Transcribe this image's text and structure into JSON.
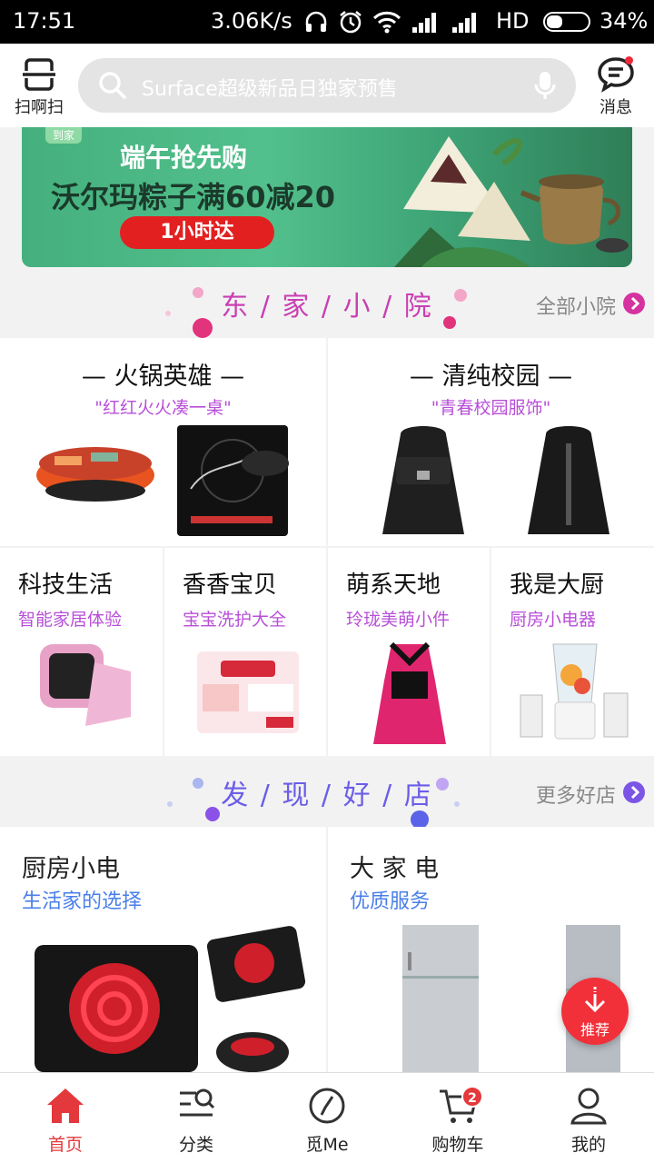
{
  "status_bar": {
    "time": "17:51",
    "net_speed": "3.06K/s",
    "network_type": "HD",
    "battery": "34%"
  },
  "topbar": {
    "scan_label": "扫啊扫",
    "search_placeholder": "Surface超级新品日独家预售",
    "message_label": "消息"
  },
  "banner": {
    "line1": "端午抢先购",
    "line2": "沃尔玛粽子满60减20",
    "cta": "1小时达",
    "badge": "到家"
  },
  "dong_section": {
    "title": "东 / 家 / 小 / 院",
    "more": "全部小院",
    "featured": [
      {
        "title": "— 火锅英雄 —",
        "subtitle": "\"红红火火凑一桌\""
      },
      {
        "title": "— 清纯校园 —",
        "subtitle": "\"青春校园服饰\""
      }
    ],
    "cells": [
      {
        "title": "科技生活",
        "subtitle": "智能家居体验"
      },
      {
        "title": "香香宝贝",
        "subtitle": "宝宝洗护大全"
      },
      {
        "title": "萌系天地",
        "subtitle": "玲珑美萌小件"
      },
      {
        "title": "我是大厨",
        "subtitle": "厨房小电器"
      }
    ]
  },
  "fa_section": {
    "title": "发 / 现 / 好 / 店",
    "more": "更多好店",
    "stores": [
      {
        "title": "厨房小电",
        "subtitle": "生活家的选择"
      },
      {
        "title": "大 家 电",
        "subtitle": "优质服务"
      }
    ]
  },
  "fab": {
    "label": "推荐"
  },
  "bottom_nav": [
    {
      "label": "首页",
      "active": true
    },
    {
      "label": "分类",
      "active": false
    },
    {
      "label": "觅Me",
      "active": false
    },
    {
      "label": "购物车",
      "active": false,
      "badge": "2"
    },
    {
      "label": "我的",
      "active": false
    }
  ],
  "colors": {
    "accent_red": "#e4393c",
    "purple_sub": "#b84fd8",
    "blue_sub": "#4a7fe8",
    "banner_green": "#45b07e"
  }
}
